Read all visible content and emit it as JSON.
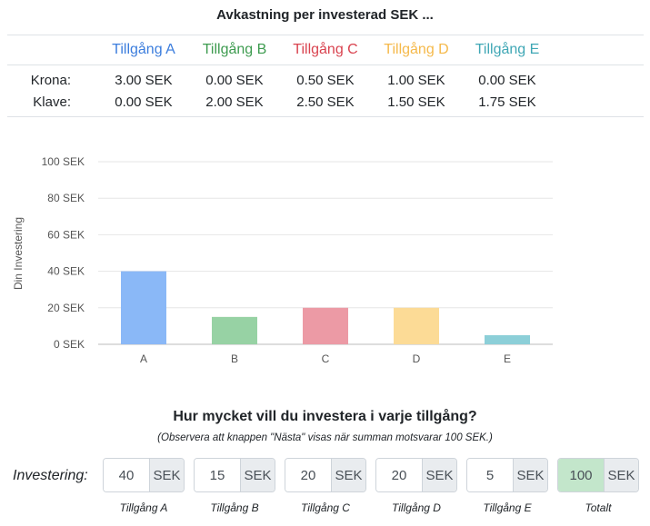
{
  "title": "Avkastning per investerad SEK ...",
  "returns_table": {
    "headers": [
      {
        "label": "Tillgång A",
        "color": "#3b7ddd"
      },
      {
        "label": "Tillgång B",
        "color": "#3d9b4f"
      },
      {
        "label": "Tillgång C",
        "color": "#d9434f"
      },
      {
        "label": "Tillgång D",
        "color": "#f5b94a"
      },
      {
        "label": "Tillgång E",
        "color": "#3fa7b5"
      }
    ],
    "rows": [
      {
        "label": "Krona:",
        "values": [
          "3.00 SEK",
          "0.00 SEK",
          "0.50 SEK",
          "1.00 SEK",
          "0.00 SEK"
        ]
      },
      {
        "label": "Klave:",
        "values": [
          "0.00 SEK",
          "2.00 SEK",
          "2.50 SEK",
          "1.50 SEK",
          "1.75 SEK"
        ]
      }
    ]
  },
  "chart_data": {
    "type": "bar",
    "categories": [
      "A",
      "B",
      "C",
      "D",
      "E"
    ],
    "values": [
      40,
      15,
      20,
      20,
      5
    ],
    "colors": [
      "#8ab8f7",
      "#97d2a4",
      "#ec9aa5",
      "#fcdb96",
      "#8ccfd8"
    ],
    "ylabel": "Din Investering",
    "ylim": [
      0,
      100
    ],
    "yticks": [
      "0 SEK",
      "20 SEK",
      "40 SEK",
      "60 SEK",
      "80 SEK",
      "100 SEK"
    ],
    "grid": true
  },
  "form": {
    "question": "Hur mycket vill du investera i varje tillgång?",
    "note": "(Observera att knappen \"Nästa\" visas när summan motsvarar 100 SEK.)",
    "row_label": "Investering:",
    "unit": "SEK",
    "inputs": [
      {
        "value": "40",
        "caption": "Tillgång A"
      },
      {
        "value": "15",
        "caption": "Tillgång B"
      },
      {
        "value": "20",
        "caption": "Tillgång C"
      },
      {
        "value": "20",
        "caption": "Tillgång D"
      },
      {
        "value": "5",
        "caption": "Tillgång E"
      }
    ],
    "total": {
      "value": "100",
      "caption": "Totalt"
    }
  }
}
